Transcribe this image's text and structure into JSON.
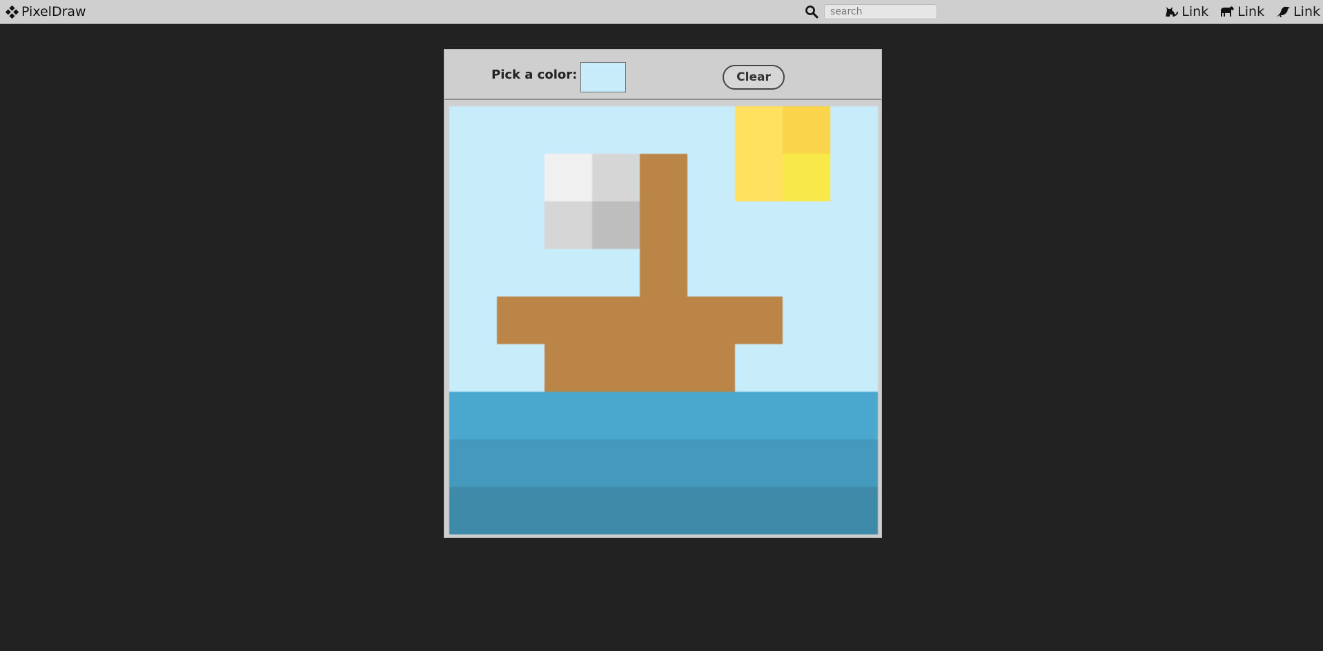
{
  "app": {
    "name": "PixelDraw",
    "logo_icon": "diamond-cluster-icon"
  },
  "header": {
    "search": {
      "icon": "search-icon",
      "placeholder": "search",
      "value": ""
    },
    "links": [
      {
        "label": "Link",
        "icon": "cat-icon"
      },
      {
        "label": "Link",
        "icon": "horse-icon"
      },
      {
        "label": "Link",
        "icon": "crow-icon"
      }
    ]
  },
  "toolbar": {
    "pick_label": "Pick a color:",
    "selected_color": "#c9ecfb",
    "clear_label": "Clear"
  },
  "canvas": {
    "palette": {
      "S": "#c9ecfb",
      "a": "#f0f0f0",
      "b": "#d6d6d6",
      "c": "#bebebe",
      "B": "#bc8548",
      "y": "#ffe15f",
      "Y": "#fad44a",
      "z": "#f9e84a",
      "1": "#4aa8ce",
      "2": "#4599bd",
      "3": "#3f8aa8"
    },
    "rows": [
      "SSSSSSyYS",
      "SSabBSyzS",
      "SSbcBSSSS",
      "SSSSBSSSS",
      "SBBBBBBSS",
      "SSBBBBSSS",
      "111111111",
      "222222222",
      "333333333"
    ]
  }
}
